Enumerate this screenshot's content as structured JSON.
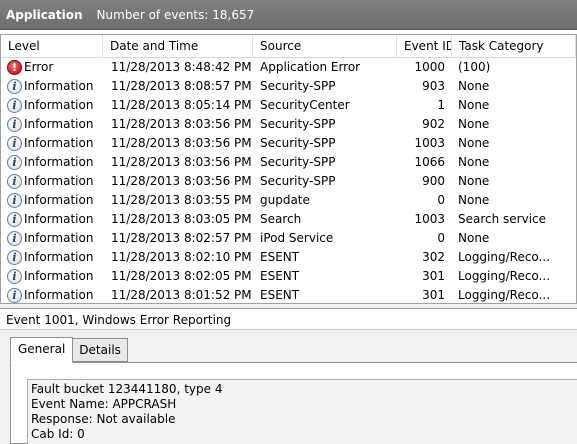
{
  "titlebar": {
    "app_label": "Application",
    "count_label": "Number of events: 18,657"
  },
  "columns": {
    "level": "Level",
    "date": "Date and Time",
    "source": "Source",
    "event_id": "Event ID",
    "task": "Task Category"
  },
  "events": [
    {
      "level": "Error",
      "icon": "error-icon",
      "date": "11/28/2013 8:48:42 PM",
      "source": "Application Error",
      "event_id": "1000",
      "task": "(100)"
    },
    {
      "level": "Information",
      "icon": "info-icon",
      "date": "11/28/2013 8:08:57 PM",
      "source": "Security-SPP",
      "event_id": "903",
      "task": "None"
    },
    {
      "level": "Information",
      "icon": "info-icon",
      "date": "11/28/2013 8:05:14 PM",
      "source": "SecurityCenter",
      "event_id": "1",
      "task": "None"
    },
    {
      "level": "Information",
      "icon": "info-icon",
      "date": "11/28/2013 8:03:56 PM",
      "source": "Security-SPP",
      "event_id": "902",
      "task": "None"
    },
    {
      "level": "Information",
      "icon": "info-icon",
      "date": "11/28/2013 8:03:56 PM",
      "source": "Security-SPP",
      "event_id": "1003",
      "task": "None"
    },
    {
      "level": "Information",
      "icon": "info-icon",
      "date": "11/28/2013 8:03:56 PM",
      "source": "Security-SPP",
      "event_id": "1066",
      "task": "None"
    },
    {
      "level": "Information",
      "icon": "info-icon",
      "date": "11/28/2013 8:03:56 PM",
      "source": "Security-SPP",
      "event_id": "900",
      "task": "None"
    },
    {
      "level": "Information",
      "icon": "info-icon",
      "date": "11/28/2013 8:03:55 PM",
      "source": "gupdate",
      "event_id": "0",
      "task": "None"
    },
    {
      "level": "Information",
      "icon": "info-icon",
      "date": "11/28/2013 8:03:05 PM",
      "source": "Search",
      "event_id": "1003",
      "task": "Search service"
    },
    {
      "level": "Information",
      "icon": "info-icon",
      "date": "11/28/2013 8:02:57 PM",
      "source": "iPod Service",
      "event_id": "0",
      "task": "None"
    },
    {
      "level": "Information",
      "icon": "info-icon",
      "date": "11/28/2013 8:02:10 PM",
      "source": "ESENT",
      "event_id": "302",
      "task": "Logging/Reco..."
    },
    {
      "level": "Information",
      "icon": "info-icon",
      "date": "11/28/2013 8:02:05 PM",
      "source": "ESENT",
      "event_id": "301",
      "task": "Logging/Reco..."
    },
    {
      "level": "Information",
      "icon": "info-icon",
      "date": "11/28/2013 8:01:52 PM",
      "source": "ESENT",
      "event_id": "301",
      "task": "Logging/Reco..."
    }
  ],
  "detail": {
    "title": "Event 1001, Windows Error Reporting",
    "tabs": [
      {
        "label": "General",
        "active": true
      },
      {
        "label": "Details",
        "active": false
      }
    ],
    "lines": [
      "Fault bucket 123441180, type 4",
      "Event Name: APPCRASH",
      "Response: Not available",
      "Cab Id: 0"
    ]
  }
}
